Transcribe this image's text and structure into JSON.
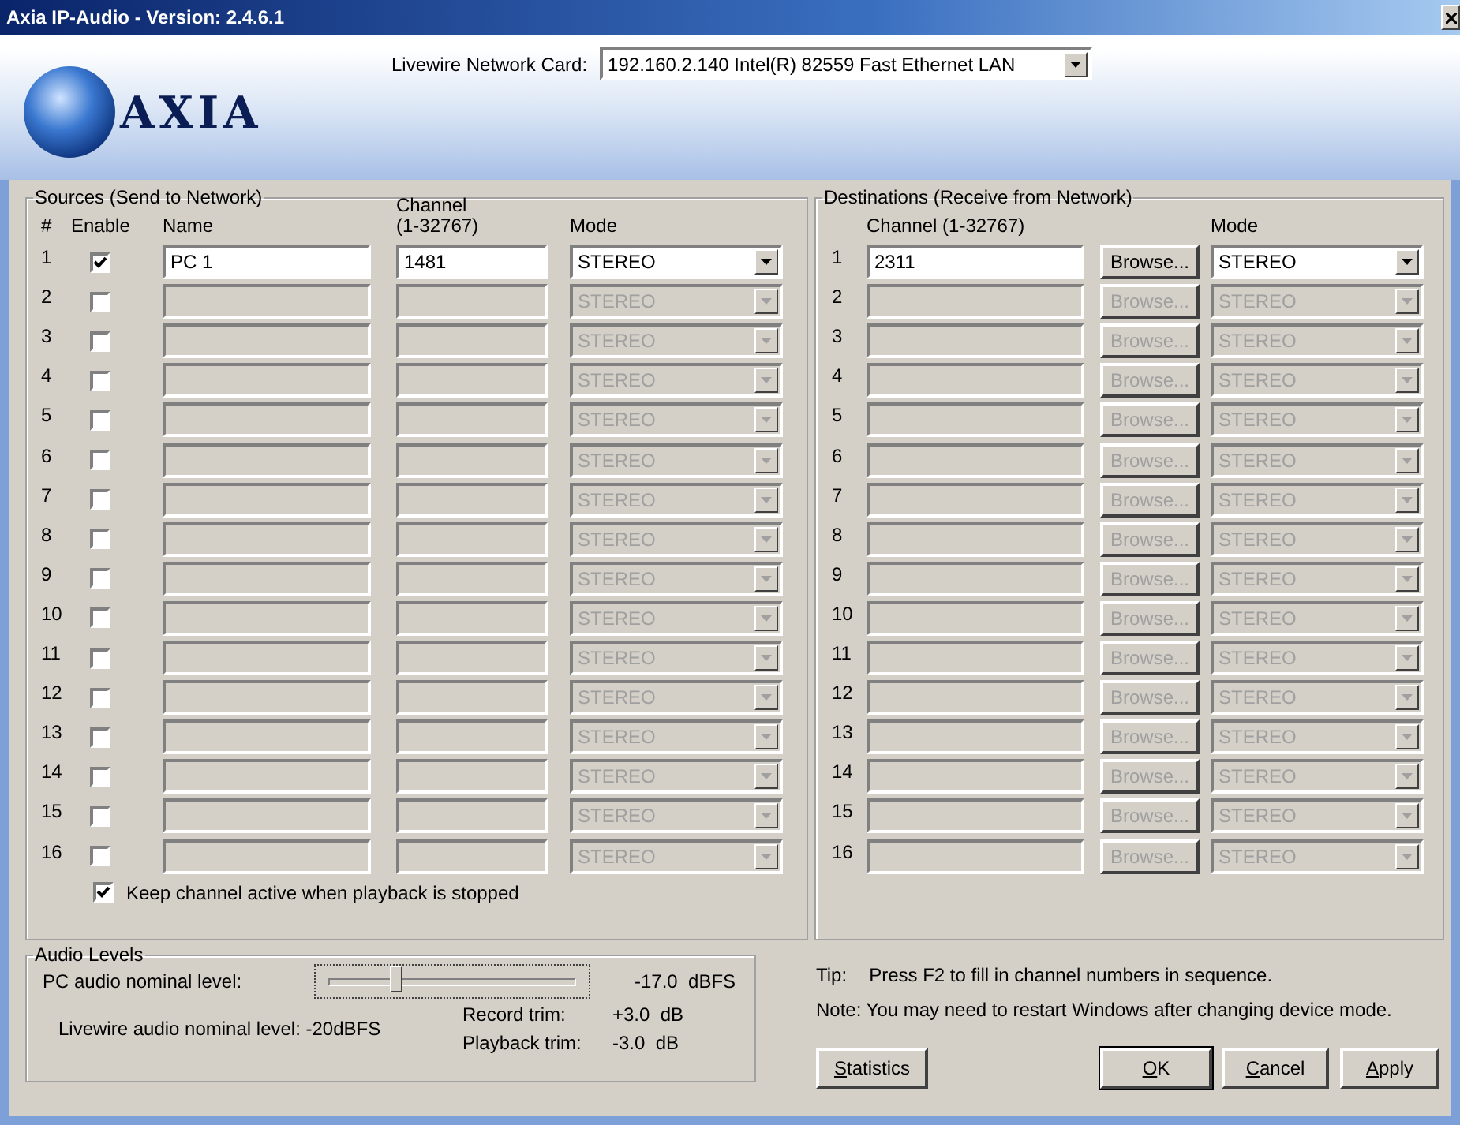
{
  "window": {
    "title": "Axia IP-Audio - Version: 2.4.6.1"
  },
  "logo": {
    "text": "AXIA"
  },
  "network_card": {
    "label": "Livewire Network Card:",
    "value": "192.160.2.140 Intel(R) 82559 Fast Ethernet LAN"
  },
  "sources": {
    "title": "Sources (Send to Network)",
    "columns": {
      "number": "#",
      "enable": "Enable",
      "name": "Name",
      "channel": "Channel (1-32767)",
      "mode": "Mode"
    },
    "rows": [
      {
        "number": "1",
        "enabled": true,
        "name": "PC 1",
        "channel": "1481",
        "mode": "STEREO"
      },
      {
        "number": "2",
        "enabled": false,
        "mode": "STEREO"
      },
      {
        "number": "3",
        "enabled": false,
        "mode": "STEREO"
      },
      {
        "number": "4",
        "enabled": false,
        "mode": "STEREO"
      },
      {
        "number": "5",
        "enabled": false,
        "mode": "STEREO"
      },
      {
        "number": "6",
        "enabled": false,
        "mode": "STEREO"
      },
      {
        "number": "7",
        "enabled": false,
        "mode": "STEREO"
      },
      {
        "number": "8",
        "enabled": false,
        "mode": "STEREO"
      },
      {
        "number": "9",
        "enabled": false,
        "mode": "STEREO"
      },
      {
        "number": "10",
        "enabled": false,
        "mode": "STEREO"
      },
      {
        "number": "11",
        "enabled": false,
        "mode": "STEREO"
      },
      {
        "number": "12",
        "enabled": false,
        "mode": "STEREO"
      },
      {
        "number": "13",
        "enabled": false,
        "mode": "STEREO"
      },
      {
        "number": "14",
        "enabled": false,
        "mode": "STEREO"
      },
      {
        "number": "15",
        "enabled": false,
        "mode": "STEREO"
      },
      {
        "number": "16",
        "enabled": false,
        "mode": "STEREO"
      }
    ],
    "keep_active": {
      "label": "Keep channel active when playback is stopped",
      "checked": true
    }
  },
  "destinations": {
    "title": "Destinations (Receive from Network)",
    "columns": {
      "channel": "Channel (1-32767)",
      "mode": "Mode"
    },
    "rows": [
      {
        "number": "1",
        "enabled": true,
        "channel": "2311",
        "browse": "Browse...",
        "mode": "STEREO"
      },
      {
        "number": "2",
        "enabled": false,
        "browse": "Browse...",
        "mode": "STEREO"
      },
      {
        "number": "3",
        "enabled": false,
        "browse": "Browse...",
        "mode": "STEREO"
      },
      {
        "number": "4",
        "enabled": false,
        "browse": "Browse...",
        "mode": "STEREO"
      },
      {
        "number": "5",
        "enabled": false,
        "browse": "Browse...",
        "mode": "STEREO"
      },
      {
        "number": "6",
        "enabled": false,
        "browse": "Browse...",
        "mode": "STEREO"
      },
      {
        "number": "7",
        "enabled": false,
        "browse": "Browse...",
        "mode": "STEREO"
      },
      {
        "number": "8",
        "enabled": false,
        "browse": "Browse...",
        "mode": "STEREO"
      },
      {
        "number": "9",
        "enabled": false,
        "browse": "Browse...",
        "mode": "STEREO"
      },
      {
        "number": "10",
        "enabled": false,
        "browse": "Browse...",
        "mode": "STEREO"
      },
      {
        "number": "11",
        "enabled": false,
        "browse": "Browse...",
        "mode": "STEREO"
      },
      {
        "number": "12",
        "enabled": false,
        "browse": "Browse...",
        "mode": "STEREO"
      },
      {
        "number": "13",
        "enabled": false,
        "browse": "Browse...",
        "mode": "STEREO"
      },
      {
        "number": "14",
        "enabled": false,
        "browse": "Browse...",
        "mode": "STEREO"
      },
      {
        "number": "15",
        "enabled": false,
        "browse": "Browse...",
        "mode": "STEREO"
      },
      {
        "number": "16",
        "enabled": false,
        "browse": "Browse...",
        "mode": "STEREO"
      }
    ]
  },
  "audio_levels": {
    "title": "Audio Levels",
    "pc_label": "PC audio nominal level:",
    "level": 0.27,
    "pc_reading": "-17.0  dBFS",
    "livewire": "Livewire audio nominal level: -20dBFS",
    "record_label": "Record trim:",
    "record_value": "+3.0  dB",
    "playback_label": "Playback trim:",
    "playback_value": "-3.0  dB"
  },
  "tip": {
    "label": "Tip:",
    "text": "Press F2 to fill in channel numbers in sequence."
  },
  "note": "Note: You may need to restart Windows after changing device mode.",
  "buttons": [
    {
      "label": "Statistics",
      "underline_first": true,
      "default": false
    },
    {
      "label": "OK",
      "underline_first": true,
      "default": true
    },
    {
      "label": "Cancel",
      "underline_first": true,
      "default": false
    },
    {
      "label": "Apply",
      "underline_first": true,
      "default": false
    }
  ]
}
